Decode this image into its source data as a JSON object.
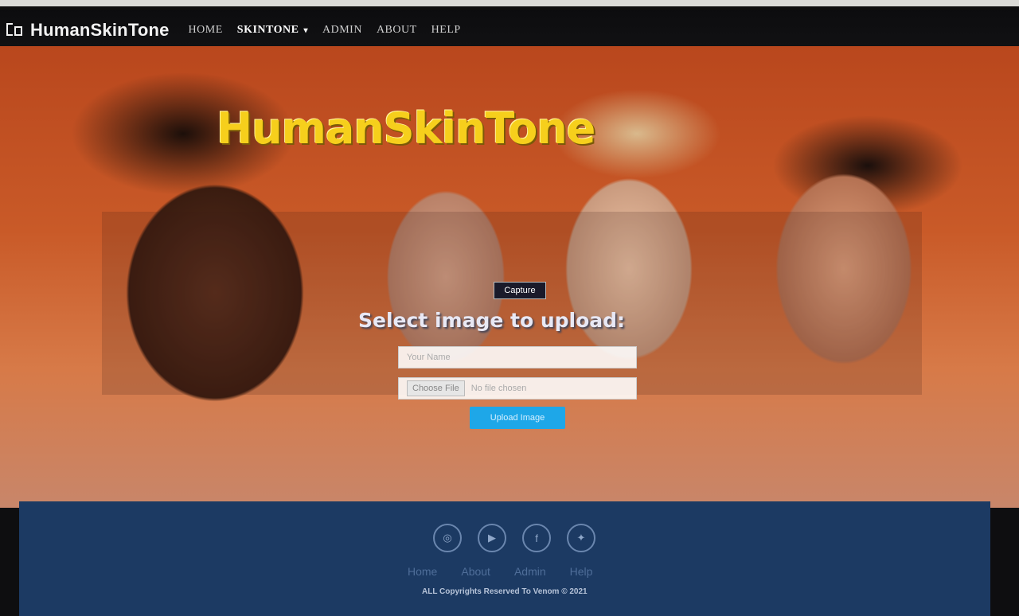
{
  "navbar": {
    "brand": "HumanSkinTone",
    "items": [
      {
        "label": "HOME"
      },
      {
        "label": "SKINTONE"
      },
      {
        "label": "ADMIN"
      },
      {
        "label": "ABOUT"
      },
      {
        "label": "HELP"
      }
    ]
  },
  "hero": {
    "title": "HumanSkinTone",
    "capture_label": "Capture",
    "upload_title": "Select image to upload:",
    "name_placeholder": "Your Name",
    "choose_file_label": "Choose File",
    "no_file_text": "No file chosen",
    "upload_button": "Upload Image"
  },
  "footer": {
    "links": [
      "Home",
      "About",
      "Admin",
      "Help"
    ],
    "copyright": "ALL Copyrights Reserved To Venom © 2021"
  }
}
